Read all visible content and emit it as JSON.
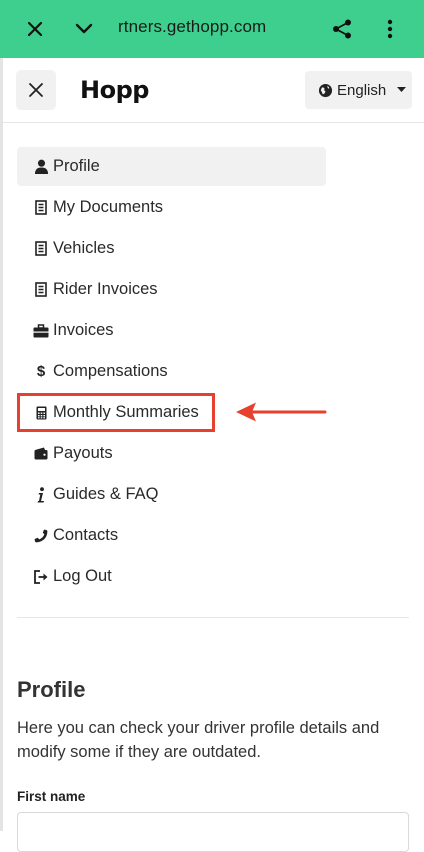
{
  "browser": {
    "url": "rtners.gethopp.com",
    "close_icon": "close-icon",
    "expand_icon": "chevron-down-icon",
    "share_icon": "share-icon",
    "more_icon": "more-vertical-icon",
    "bar_color": "#3ecf8e"
  },
  "header": {
    "brand": "Hopp",
    "language": "English",
    "close_icon": "close-icon"
  },
  "menu": {
    "items": [
      {
        "label": "Profile",
        "icon": "user-icon",
        "active": true
      },
      {
        "label": "My Documents",
        "icon": "document-icon"
      },
      {
        "label": "Vehicles",
        "icon": "document-icon"
      },
      {
        "label": "Rider Invoices",
        "icon": "document-icon"
      },
      {
        "label": "Invoices",
        "icon": "briefcase-icon"
      },
      {
        "label": "Compensations",
        "icon": "dollar-icon"
      },
      {
        "label": "Monthly Summaries",
        "icon": "calculator-icon",
        "highlighted": true
      },
      {
        "label": "Payouts",
        "icon": "wallet-icon"
      },
      {
        "label": "Guides & FAQ",
        "icon": "info-icon"
      },
      {
        "label": "Contacts",
        "icon": "phone-icon"
      },
      {
        "label": "Log Out",
        "icon": "logout-icon"
      }
    ],
    "highlight_color": "#e8402e"
  },
  "profile": {
    "title": "Profile",
    "description": "Here you can check your driver profile details and modify some if they are outdated.",
    "first_name_label": "First name",
    "first_name_value": ""
  }
}
